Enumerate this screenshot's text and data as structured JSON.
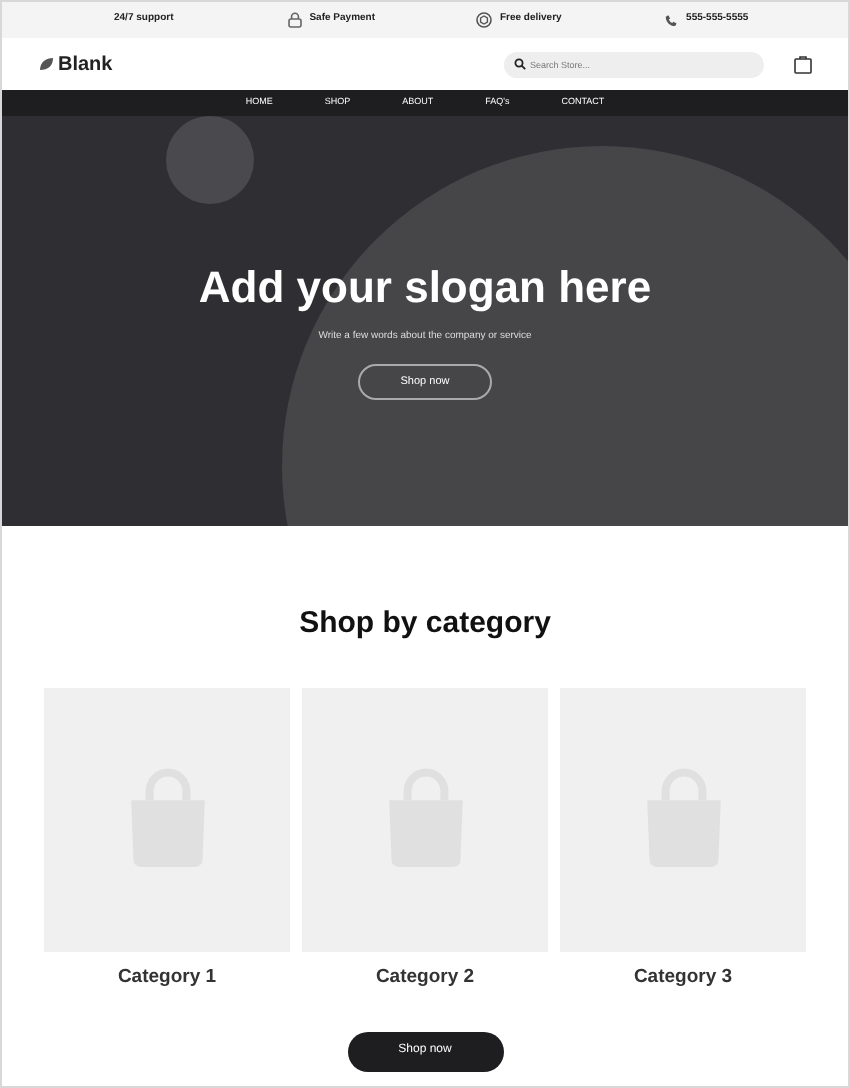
{
  "topbar": [
    {
      "kind": "text",
      "label": "24/7 support"
    },
    {
      "kind": "lock",
      "label": "Safe Payment"
    },
    {
      "kind": "box",
      "label": "Free delivery"
    },
    {
      "kind": "phone",
      "label": "555-555-5555"
    }
  ],
  "header": {
    "logo": "Blank",
    "search": {
      "placeholder": "Search Store..."
    }
  },
  "nav": [
    "HOME",
    "SHOP",
    "ABOUT",
    "FAQ's",
    "CONTACT"
  ],
  "hero": {
    "title": "Add your slogan here",
    "subtitle": "Write a few words about the company or service",
    "button": "Shop now"
  },
  "categories": {
    "title": "Shop by category",
    "items": [
      {
        "name": "Category 1"
      },
      {
        "name": "Category 2"
      },
      {
        "name": "Category 3"
      }
    ],
    "button": "Shop now"
  }
}
